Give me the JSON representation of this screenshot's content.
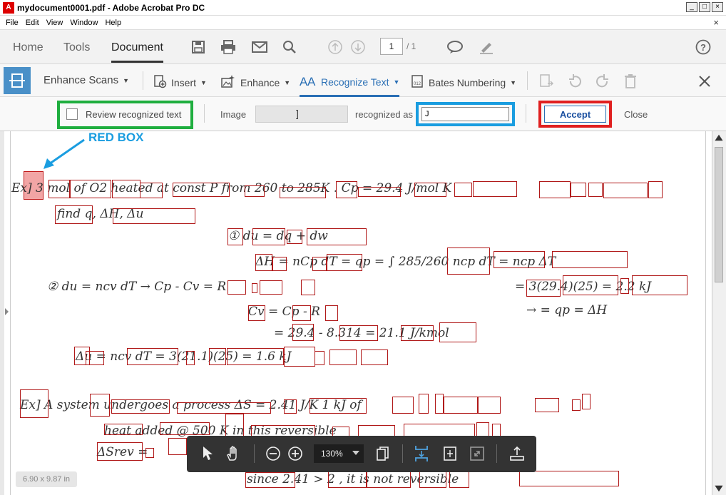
{
  "window": {
    "title": "mydocument0001.pdf - Adobe Acrobat Pro DC",
    "app_icon": "acrobat-icon"
  },
  "menu": [
    "File",
    "Edit",
    "View",
    "Window",
    "Help"
  ],
  "nav_tabs": {
    "home": "Home",
    "tools": "Tools",
    "document": "Document"
  },
  "page_nav": {
    "current": "1",
    "total": "/ 1"
  },
  "scan_toolbar": {
    "title": "Enhance Scans",
    "insert": "Insert",
    "enhance": "Enhance",
    "recognize": "Recognize Text",
    "bates": "Bates Numbering"
  },
  "recognize_bar": {
    "review_label": "Review recognized text",
    "image_label": "Image",
    "image_glyph": "]",
    "recognized_as_label": "recognized as",
    "recognized_value": "J",
    "accept": "Accept",
    "close": "Close"
  },
  "annotation": {
    "label": "RED BOX",
    "colors": {
      "green": "#1fae3f",
      "blue": "#1a9de0",
      "red": "#e02020"
    }
  },
  "handwriting": {
    "l1": "Ex]  3  mol  of  O2  heated  at  const  P  from  260  to  285K .  Cp = 29.4 J/mol K",
    "l2": "find   q, ΔH, Δu",
    "l3": "① du = dq + dw",
    "l4": "ΔH = nCp dT  = qp  =  ∫ 285/260  ncp dT  = ncp ΔT",
    "l5": "② du = ncv dT  →  Cp - Cv = R",
    "l5b": "= 3(29.4)(25) = 2.2 kJ",
    "l6": "Cv = Cp - R",
    "l6b": "→  = qp = ΔH",
    "l7": "= 29.4 - 8.314 = 21.1 J/kmol",
    "l8": "Δu = ncv dT = 3(21.1)(25) = 1.6 kJ",
    "l9": "Ex]   A  system  undergoes  a  process   ΔS = 2.41 J/K    1 kJ  of",
    "l10": "heat  added  @  500 K  in  this  reversible",
    "l11": "ΔSrev =",
    "l12": "since  2.41 > 2 ,  it  is  not  reversible"
  },
  "float_toolbar": {
    "zoom": "130%"
  },
  "page_size": "6.90 x 9.87 in"
}
